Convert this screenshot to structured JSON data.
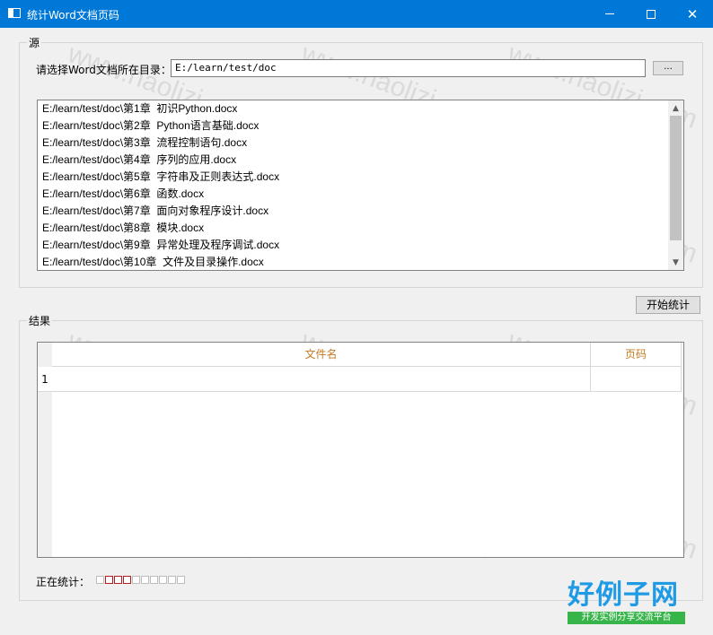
{
  "window": {
    "title": "统计Word文档页码",
    "minimize_glyph": "—",
    "maximize_glyph": "☐",
    "close_glyph": "✕"
  },
  "source_group": {
    "title": "源",
    "dir_label": "请选择Word文档所在目录：",
    "dir_value": "E:/learn/test/doc",
    "browse_label": "...",
    "files": [
      "E:/learn/test/doc\\第1章  初识Python.docx",
      "E:/learn/test/doc\\第2章  Python语言基础.docx",
      "E:/learn/test/doc\\第3章  流程控制语句.docx",
      "E:/learn/test/doc\\第4章  序列的应用.docx",
      "E:/learn/test/doc\\第5章  字符串及正则表达式.docx",
      "E:/learn/test/doc\\第6章  函数.docx",
      "E:/learn/test/doc\\第7章  面向对象程序设计.docx",
      "E:/learn/test/doc\\第8章  模块.docx",
      "E:/learn/test/doc\\第9章  异常处理及程序调试.docx",
      "E:/learn/test/doc\\第10章  文件及目录操作.docx"
    ]
  },
  "start_button_label": "开始统计",
  "result_group": {
    "title": "结果",
    "columns": [
      "文件名",
      "页码"
    ],
    "rows": [
      {
        "index": "1",
        "name": "",
        "pages": ""
      }
    ],
    "header_color": "#c37a20"
  },
  "status": {
    "label": "正在统计：",
    "progress_segments": 10,
    "progress_active": [
      1,
      2,
      3
    ],
    "progress_active_color": "#b02020"
  },
  "watermark_text": "www.haolizi.com",
  "logo": {
    "main": "好例子网",
    "sub": "开发实例分享交流平台"
  },
  "colors": {
    "titlebar": "#0078d7",
    "logo_main": "#1f9be6",
    "logo_sub_bg": "#38b54a"
  }
}
